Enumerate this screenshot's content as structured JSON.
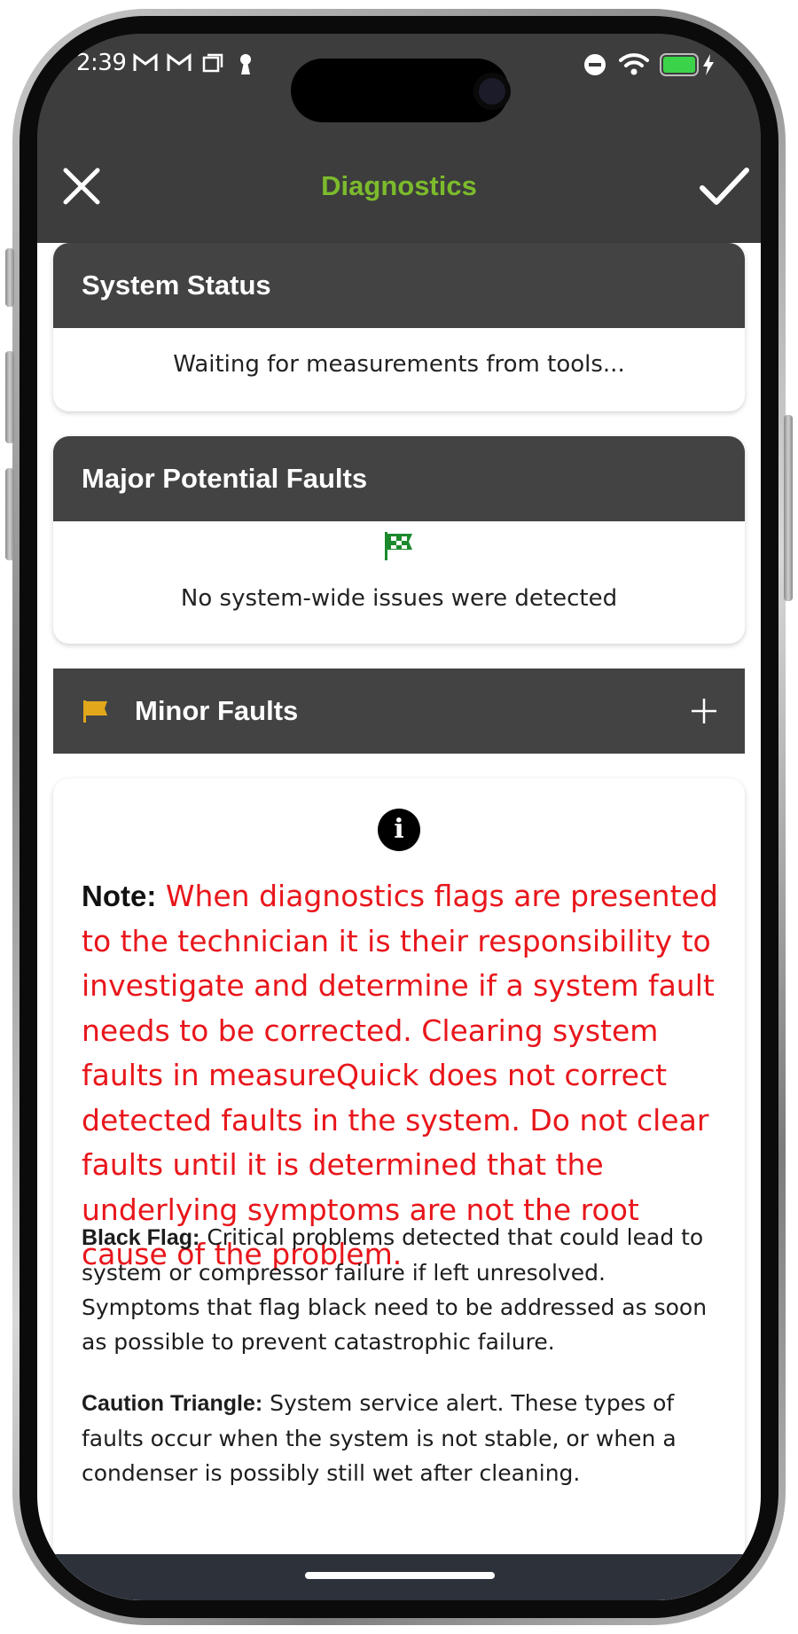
{
  "status_bar": {
    "time": "2:39",
    "left_icons": [
      "gmail-icon",
      "gmail-icon",
      "square-icon",
      "keyhole-icon"
    ],
    "right_icons": [
      "do-not-disturb-icon",
      "wifi-icon",
      "battery-charging-icon"
    ],
    "battery_color": "#3bd34a"
  },
  "toolbar": {
    "title": "Diagnostics",
    "title_color": "#7cbb2c",
    "close_icon": "close-icon",
    "confirm_icon": "check-icon"
  },
  "system_status": {
    "header": "System Status",
    "message": "Waiting for measurements from tools..."
  },
  "major_faults": {
    "header": "Major Potential Faults",
    "icon": "checkered-flag-icon",
    "message": "No system-wide issues were detected"
  },
  "minor_faults": {
    "header": "Minor Faults",
    "icon": "yellow-flag-icon",
    "expand_icon": "plus-icon"
  },
  "info_card": {
    "icon": "info-icon",
    "note_label": "Note:",
    "note_text": "When diagnostics flags are presented to the technician it is their responsibility to investigate and determine if a system fault needs to be corrected. Clearing system faults in measureQuick does not correct detected faults in the system. Do not clear faults until it is determined that the underlying symptoms are not the root cause of the problem.",
    "black_flag_label": "Black Flag:",
    "black_flag_text": "Critical problems detected that could lead to system or compressor failure if left unresolved. Symptoms that flag black need to be addressed as soon as possible to prevent catastrophic failure.",
    "caution_label": "Caution Triangle:",
    "caution_text": "System service alert. These types of faults occur when the system is not stable, or when a condenser is possibly still wet after cleaning."
  }
}
